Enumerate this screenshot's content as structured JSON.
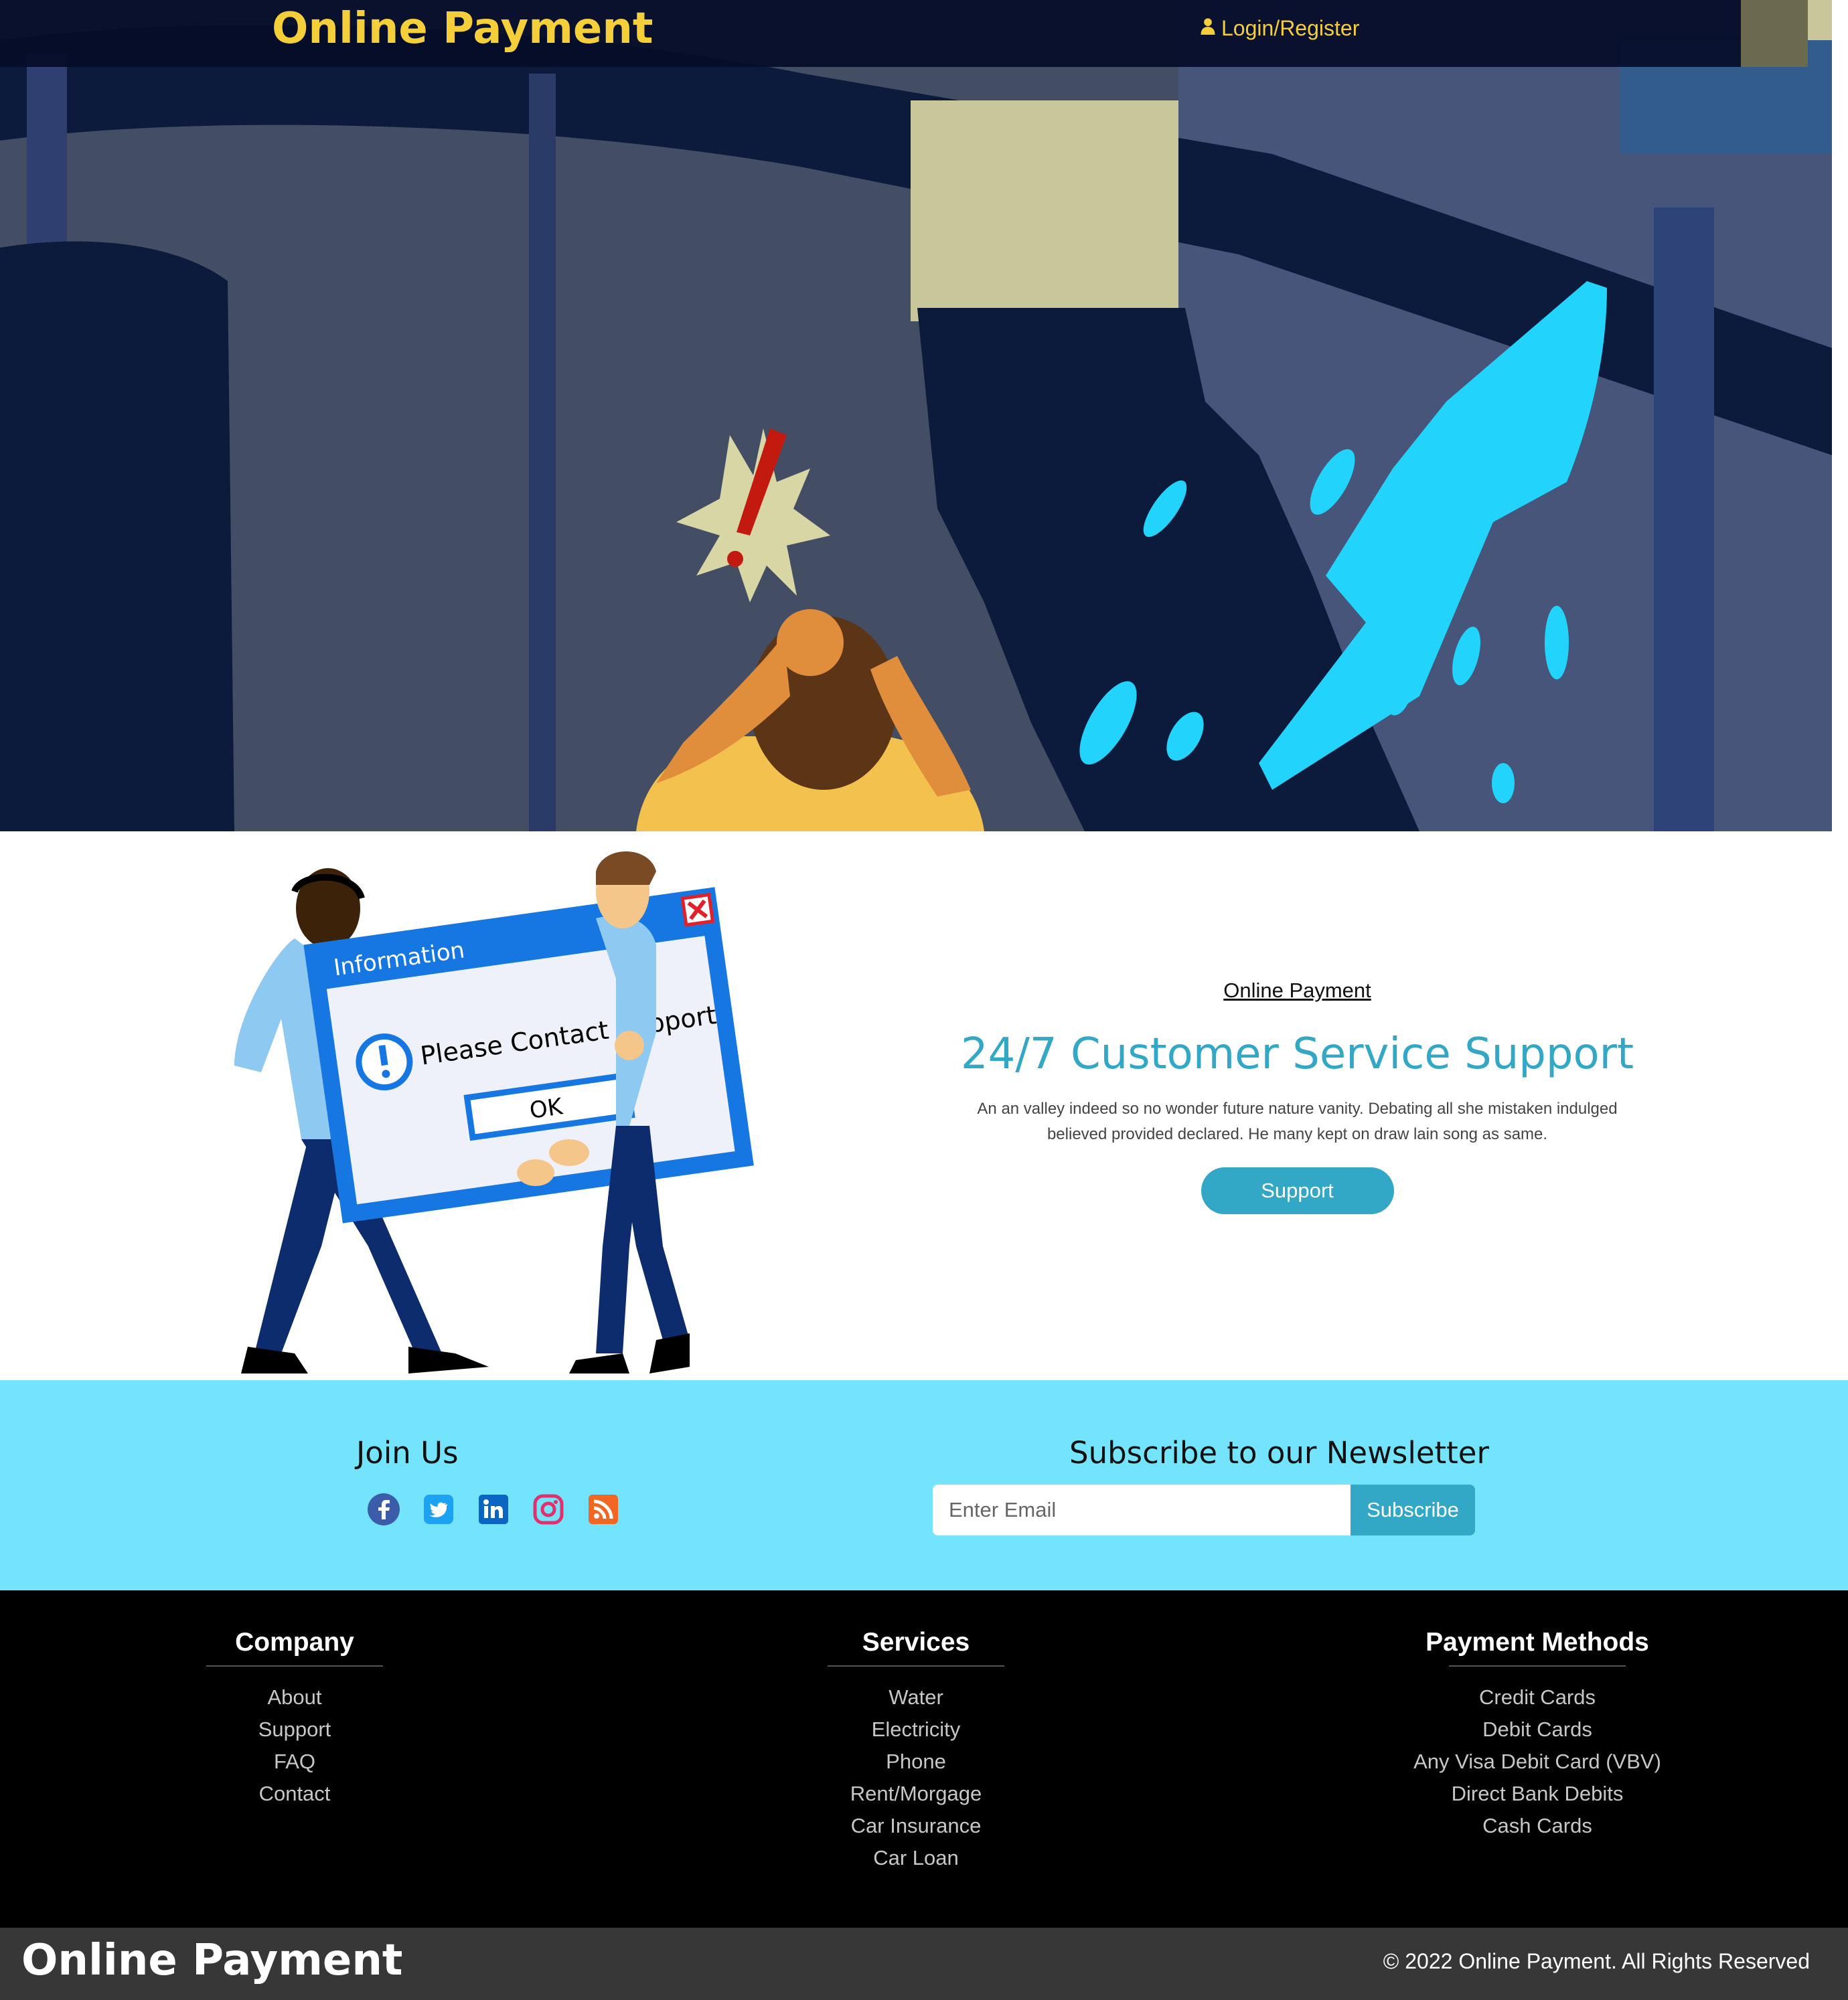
{
  "navbar": {
    "brand": "Online Payment",
    "login_label": "Login/Register",
    "icon": "user-icon"
  },
  "colors": {
    "brand_yellow": "#f5cf3a",
    "accent": "#33a7c6",
    "band": "#74e4fc",
    "footer_bg": "#000000",
    "bottom_bar_bg": "#373737"
  },
  "support": {
    "eyebrow": "Online Payment",
    "title": "24/7 Customer Service Support",
    "description": "An an valley indeed so no wonder future nature vanity. Debating all she mistaken indulged believed provided declared. He many kept on draw lain song as same.",
    "button_label": "Support",
    "illustration": {
      "window_title": "Information",
      "message": "Please Contact Support",
      "ok_label": "OK"
    }
  },
  "join": {
    "title": "Join Us",
    "socials": [
      "facebook-icon",
      "twitter-icon",
      "linkedin-icon",
      "instagram-icon",
      "rss-icon"
    ]
  },
  "newsletter": {
    "title": "Subscribe to our Newsletter",
    "placeholder": "Enter Email",
    "button_label": "Subscribe"
  },
  "footer": {
    "columns": [
      {
        "heading": "Company",
        "links": [
          "About",
          "Support",
          "FAQ",
          "Contact"
        ]
      },
      {
        "heading": "Services",
        "links": [
          "Water",
          "Electricity",
          "Phone",
          "Rent/Morgage",
          "Car Insurance",
          "Car Loan"
        ]
      },
      {
        "heading": "Payment Methods",
        "links": [
          "Credit Cards",
          "Debit Cards",
          "Any Visa Debit Card (VBV)",
          "Direct Bank Debits",
          "Cash Cards"
        ]
      }
    ]
  },
  "bottom_bar": {
    "brand": "Online Payment",
    "copyright": "© 2022 Online Payment. All Rights Reserved"
  }
}
